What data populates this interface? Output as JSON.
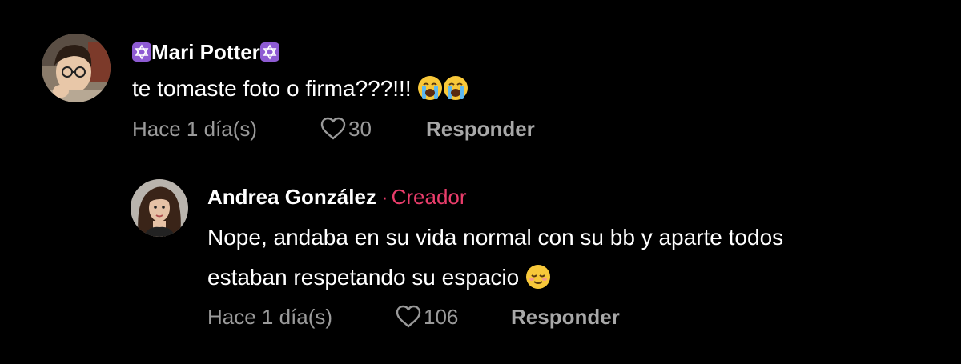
{
  "comments": [
    {
      "username": "Mari Potter",
      "badge_icon": "star-of-david-icon",
      "text": "te tomaste foto o firma???!!!",
      "emojis": [
        "loudly-crying-face",
        "loudly-crying-face"
      ],
      "time": "Hace 1 día(s)",
      "likes": "30",
      "reply_label": "Responder"
    }
  ],
  "replies": [
    {
      "username": "Andrea González",
      "separator": "·",
      "creator_label": "Creador",
      "text_line_1": "Nope, andaba en su vida normal con su bb y aparte todos",
      "text_line_2": "estaban respetando su espacio",
      "emoji": "relieved-face",
      "time": "Hace 1 día(s)",
      "likes": "106",
      "reply_label": "Responder"
    }
  ],
  "colors": {
    "background": "#000000",
    "text": "#ffffff",
    "meta": "#9a9a9a",
    "creator_accent": "#ea3d6b",
    "badge": "#8e5bd3"
  }
}
